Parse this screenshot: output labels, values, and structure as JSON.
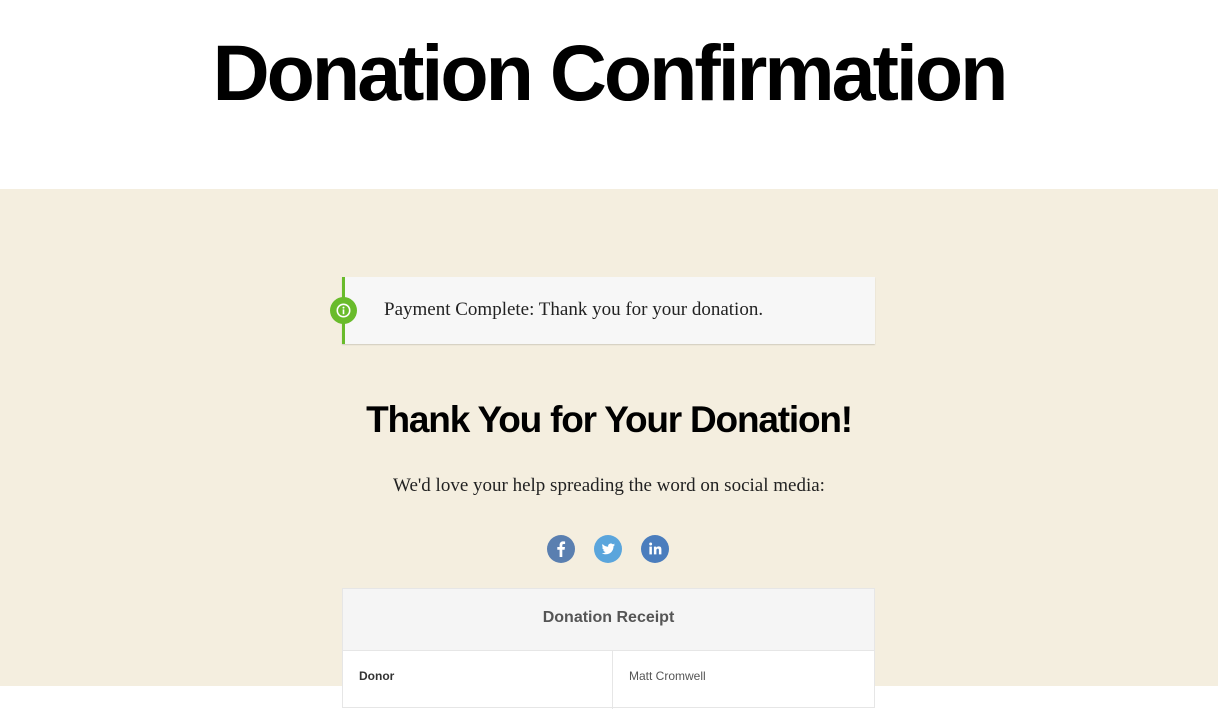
{
  "page": {
    "title": "Donation Confirmation"
  },
  "notice": {
    "icon": "info-icon",
    "text": "Payment Complete: Thank you for your donation.",
    "accent_color": "#69bb2b"
  },
  "thanks": {
    "heading": "Thank You for Your Donation!",
    "share_prompt": "We'd love your help spreading the word on social media:"
  },
  "social": [
    {
      "name": "facebook-icon",
      "color": "#5a7fb0"
    },
    {
      "name": "twitter-icon",
      "color": "#5aa5dc"
    },
    {
      "name": "linkedin-icon",
      "color": "#4a7dbd"
    }
  ],
  "receipt": {
    "title": "Donation Receipt",
    "rows": [
      {
        "label": "Donor",
        "value": "Matt Cromwell"
      }
    ]
  },
  "colors": {
    "content_background": "#f4eedf",
    "header_background": "#ffffff"
  }
}
